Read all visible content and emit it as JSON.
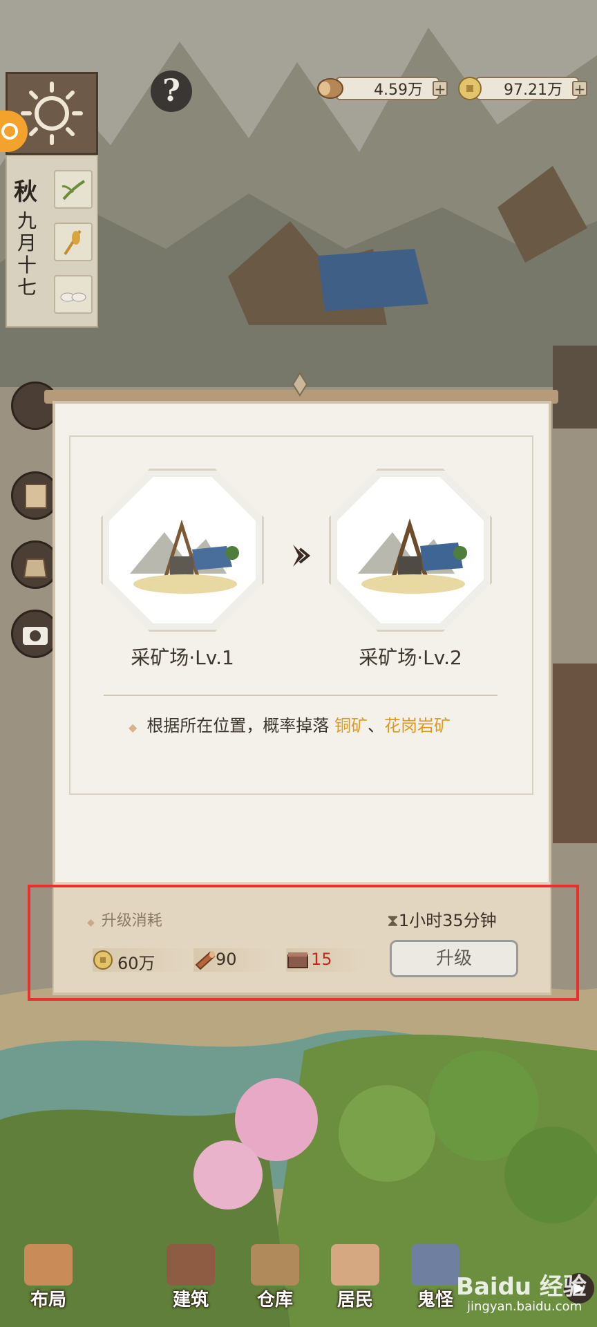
{
  "hud": {
    "wood_amount": "4.59万",
    "coin_amount": "97.21万",
    "plus": "+"
  },
  "calendar": {
    "season": "秋",
    "date_chars": [
      "九",
      "月",
      "十",
      "七"
    ]
  },
  "dialog": {
    "current": {
      "name": "采矿场·Lv.1"
    },
    "next": {
      "name": "采矿场·Lv.2"
    },
    "description": {
      "prefix": "根据所在位置，概率掉落 ",
      "item1": "铜矿",
      "sep": "、",
      "item2": "花岗岩矿"
    },
    "cost": {
      "title": "升级消耗",
      "duration": "1小时35分钟",
      "coin": "60万",
      "wood": "90",
      "stone": "15",
      "upgrade_label": "升级"
    }
  },
  "nav": {
    "items": [
      {
        "label": "布局"
      },
      {
        "label": "建筑"
      },
      {
        "label": "仓库"
      },
      {
        "label": "居民"
      },
      {
        "label": "鬼怪"
      }
    ]
  },
  "watermark": {
    "brand": "Baidu 经验",
    "url": "jingyan.baidu.com"
  },
  "colors": {
    "highlight": "#dc9a20",
    "insufficient": "#c0291f",
    "annotation_box": "#e8302f"
  }
}
